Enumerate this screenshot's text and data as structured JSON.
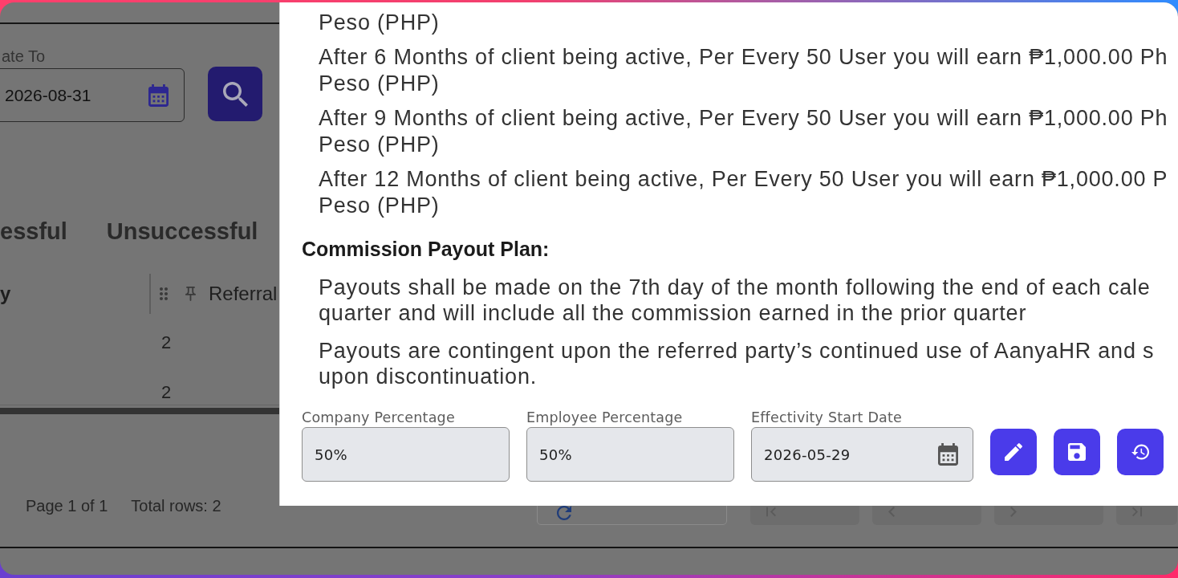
{
  "background_page": {
    "date_to": {
      "label": "ate To",
      "value": "2026-08-31"
    },
    "tabs": [
      {
        "label": "essful"
      },
      {
        "label": "Unsuccessful"
      }
    ],
    "table": {
      "columns": [
        {
          "label": "y"
        },
        {
          "label": "Referral"
        }
      ],
      "rows": [
        {
          "column_2": "2"
        },
        {
          "column_2": "2"
        }
      ]
    },
    "footer": {
      "page_info": "Page 1 of 1",
      "total_rows": "Total rows: 2",
      "pagination": [
        {
          "kind": "first",
          "disabled": true
        },
        {
          "kind": "prev",
          "disabled": true
        },
        {
          "kind": "next",
          "disabled": true
        },
        {
          "kind": "last",
          "disabled": true
        }
      ]
    }
  },
  "dialog": {
    "earning_items": [
      {
        "text": "Peso (PHP)"
      },
      {
        "text": "After 6 Months of client being active, Per Every 50 User you will earn ₱1,000.00 Ph\nPeso (PHP)"
      },
      {
        "text": "After 9 Months of client being active, Per Every 50 User you will earn ₱1,000.00 Ph\nPeso (PHP)"
      },
      {
        "text": "After 12 Months of client being active, Per Every 50 User you will earn ₱1,000.00 P\nPeso (PHP)"
      }
    ],
    "payout_heading": "Commission Payout Plan:",
    "payout_items": [
      {
        "text": "Payouts shall be made on the 7th day of the month following the end of each cale\nquarter and will include all the commission earned in the prior quarter"
      },
      {
        "text": "Payouts are contingent upon the referred party’s continued use of AanyaHR and s\nupon discontinuation."
      }
    ],
    "fields": [
      {
        "kind": "text",
        "label": "Company Percentage",
        "value": "50%",
        "disabled": true
      },
      {
        "kind": "text",
        "label": "Employee Percentage",
        "value": "50%",
        "disabled": true
      },
      {
        "kind": "date",
        "label": "Effectivity Start Date",
        "value": "2026-05-29",
        "disabled": true
      }
    ]
  }
}
